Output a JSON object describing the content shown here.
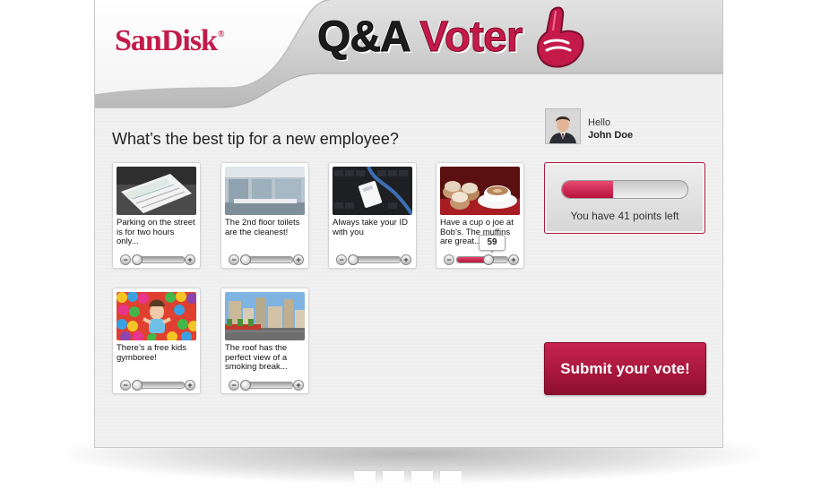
{
  "app": {
    "brand": "SanDisk",
    "brand_mark": "®",
    "title_part1": "Q&A",
    "title_part2": "Voter",
    "brand_color": "#c41a4a"
  },
  "question": "What’s the best tip for a new employee?",
  "user": {
    "greeting": "Hello",
    "name": "John Doe"
  },
  "points": {
    "label": "You have 41 points left",
    "remaining_fraction": 0.41
  },
  "submit_label": "Submit your vote!",
  "tips": [
    {
      "caption": "Parking on the street is for two hours only...",
      "thumb": "parking-ticket-photo",
      "vote_fraction": 0.0
    },
    {
      "caption": "The 2nd floor toilets are the cleanest!",
      "thumb": "restroom-photo",
      "vote_fraction": 0.0
    },
    {
      "caption": "Always take your ID with you",
      "thumb": "id-badge-photo",
      "vote_fraction": 0.0
    },
    {
      "caption": "Have a cup o joe at Bob’s. The muffins are great...",
      "thumb": "coffee-muffins-photo",
      "vote_fraction": 0.59,
      "vote_value": "59"
    },
    {
      "caption": "There’s a free kids gymboree!",
      "thumb": "ball-pit-photo",
      "vote_fraction": 0.0
    },
    {
      "caption": "The roof has the perfect view of a smoking break...",
      "thumb": "rooftop-city-photo",
      "vote_fraction": 0.0
    }
  ],
  "icons": {
    "minus": "−",
    "plus": "+",
    "foam_finger": "foam-finger-icon"
  }
}
